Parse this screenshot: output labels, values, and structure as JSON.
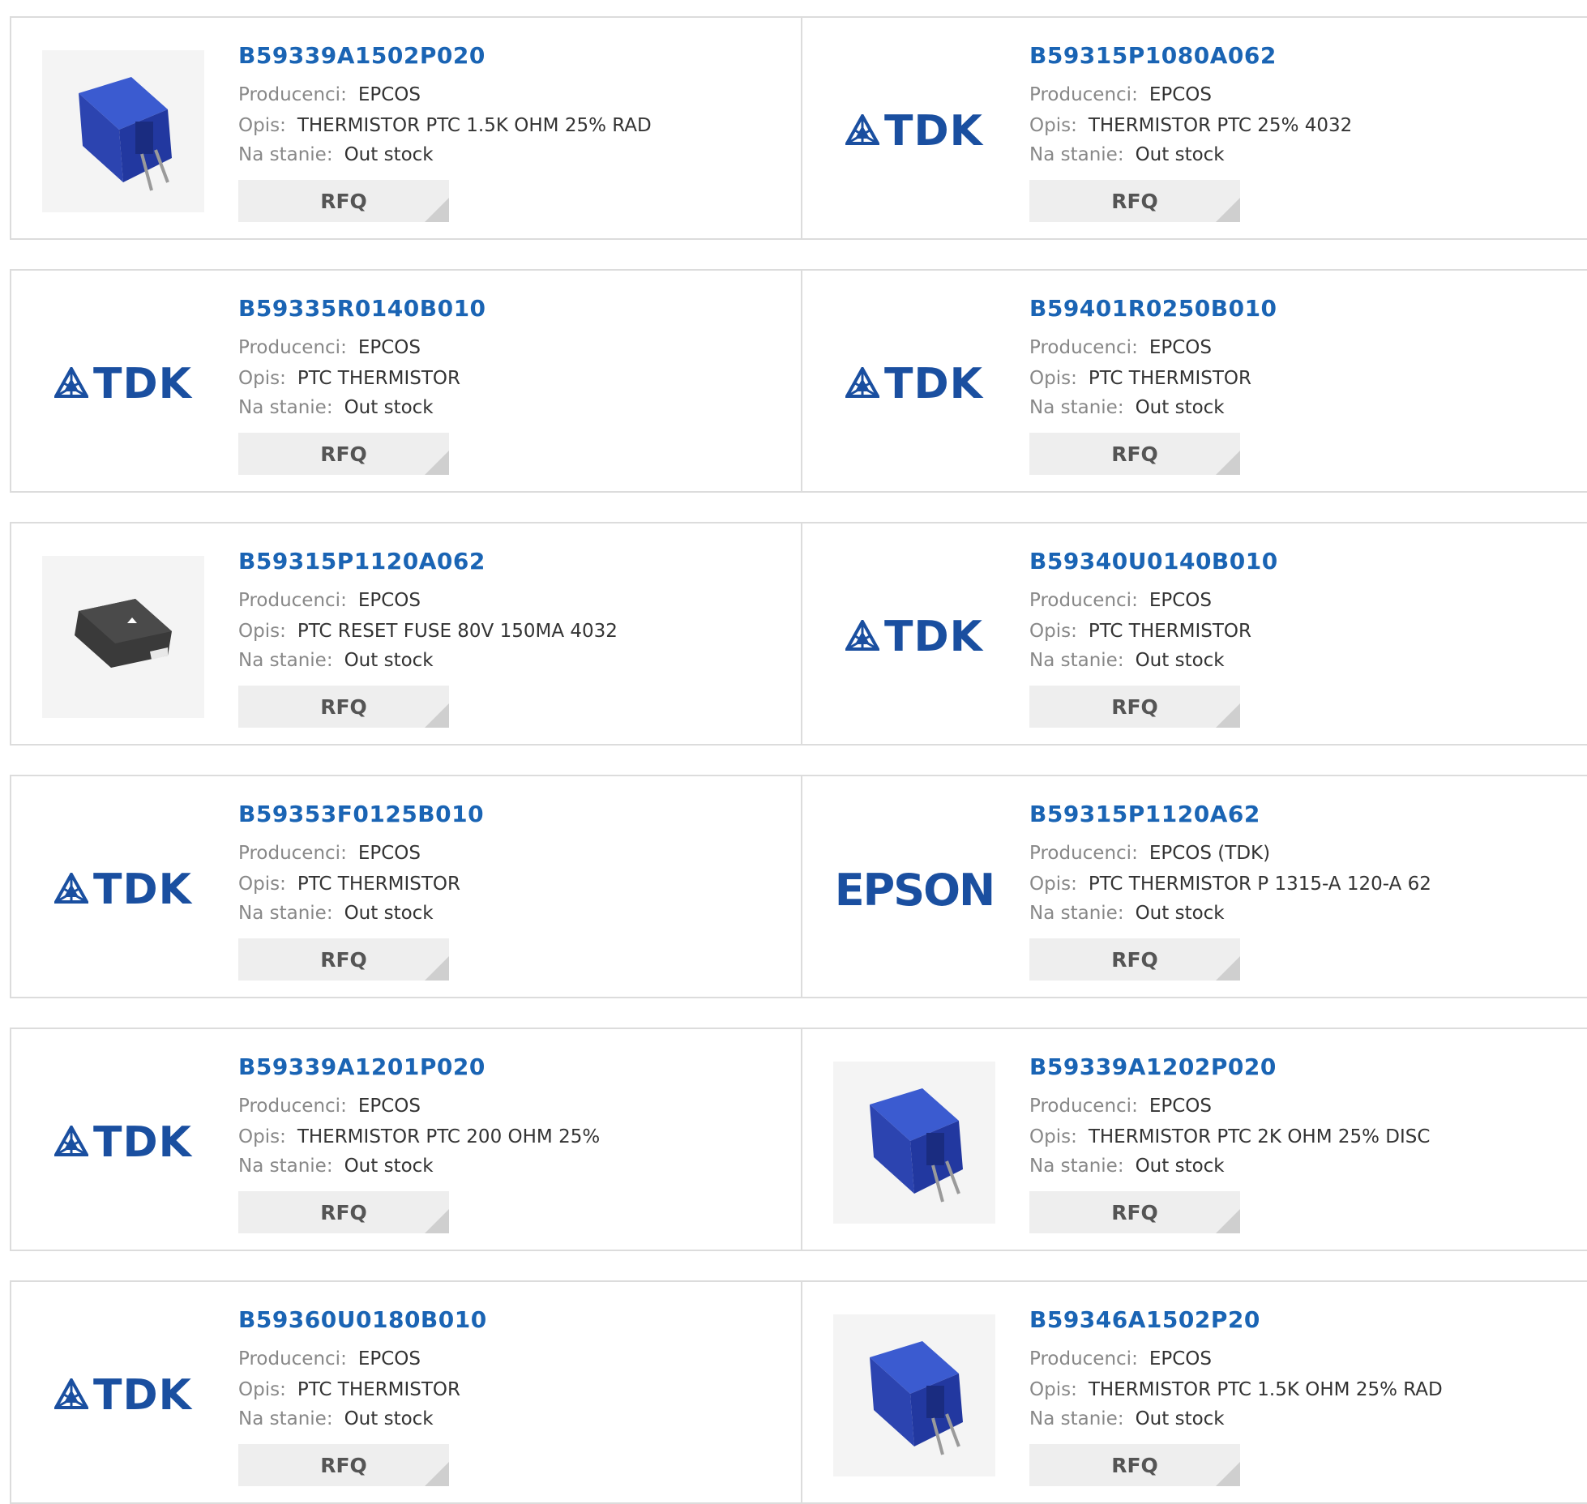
{
  "labels": {
    "manufacturer": "Producenci:",
    "description": "Opis:",
    "stock": "Na stanie:",
    "rfq": "RFQ"
  },
  "colors": {
    "link": "#1a64b4",
    "logo": "#1a4fa0",
    "border": "#dcdcdc"
  },
  "products": [
    {
      "part_number": "B59339A1502P020",
      "manufacturer": "EPCOS",
      "description": "THERMISTOR PTC 1.5K OHM 25% RAD",
      "stock": "Out stock",
      "image": "blue-radial-thermistor-photo"
    },
    {
      "part_number": "B59315P1080A062",
      "manufacturer": "EPCOS",
      "description": "THERMISTOR PTC 25% 4032",
      "stock": "Out stock",
      "image": "tdk-logo",
      "logo_text": "TDK"
    },
    {
      "part_number": "B59335R0140B010",
      "manufacturer": "EPCOS",
      "description": "PTC THERMISTOR",
      "stock": "Out stock",
      "image": "tdk-logo",
      "logo_text": "TDK"
    },
    {
      "part_number": "B59401R0250B010",
      "manufacturer": "EPCOS",
      "description": "PTC THERMISTOR",
      "stock": "Out stock",
      "image": "tdk-logo",
      "logo_text": "TDK"
    },
    {
      "part_number": "B59315P1120A062",
      "manufacturer": "EPCOS",
      "description": "PTC RESET FUSE 80V 150MA 4032",
      "stock": "Out stock",
      "image": "black-smd-fuse-photo"
    },
    {
      "part_number": "B59340U0140B010",
      "manufacturer": "EPCOS",
      "description": "PTC THERMISTOR",
      "stock": "Out stock",
      "image": "tdk-logo",
      "logo_text": "TDK"
    },
    {
      "part_number": "B59353F0125B010",
      "manufacturer": "EPCOS",
      "description": "PTC THERMISTOR",
      "stock": "Out stock",
      "image": "tdk-logo",
      "logo_text": "TDK"
    },
    {
      "part_number": "B59315P1120A62",
      "manufacturer": "EPCOS (TDK)",
      "description": "PTC THERMISTOR P 1315-A 120-A 62",
      "stock": "Out stock",
      "image": "epson-logo",
      "logo_text": "EPSON"
    },
    {
      "part_number": "B59339A1201P020",
      "manufacturer": "EPCOS",
      "description": "THERMISTOR PTC 200 OHM 25%",
      "stock": "Out stock",
      "image": "tdk-logo",
      "logo_text": "TDK"
    },
    {
      "part_number": "B59339A1202P020",
      "manufacturer": "EPCOS",
      "description": "THERMISTOR PTC 2K OHM 25% DISC",
      "stock": "Out stock",
      "image": "blue-radial-thermistor-photo"
    },
    {
      "part_number": "B59360U0180B010",
      "manufacturer": "EPCOS",
      "description": "PTC THERMISTOR",
      "stock": "Out stock",
      "image": "tdk-logo",
      "logo_text": "TDK"
    },
    {
      "part_number": "B59346A1502P20",
      "manufacturer": "EPCOS",
      "description": "THERMISTOR PTC 1.5K OHM 25% RAD",
      "stock": "Out stock",
      "image": "blue-radial-thermistor-photo"
    }
  ]
}
